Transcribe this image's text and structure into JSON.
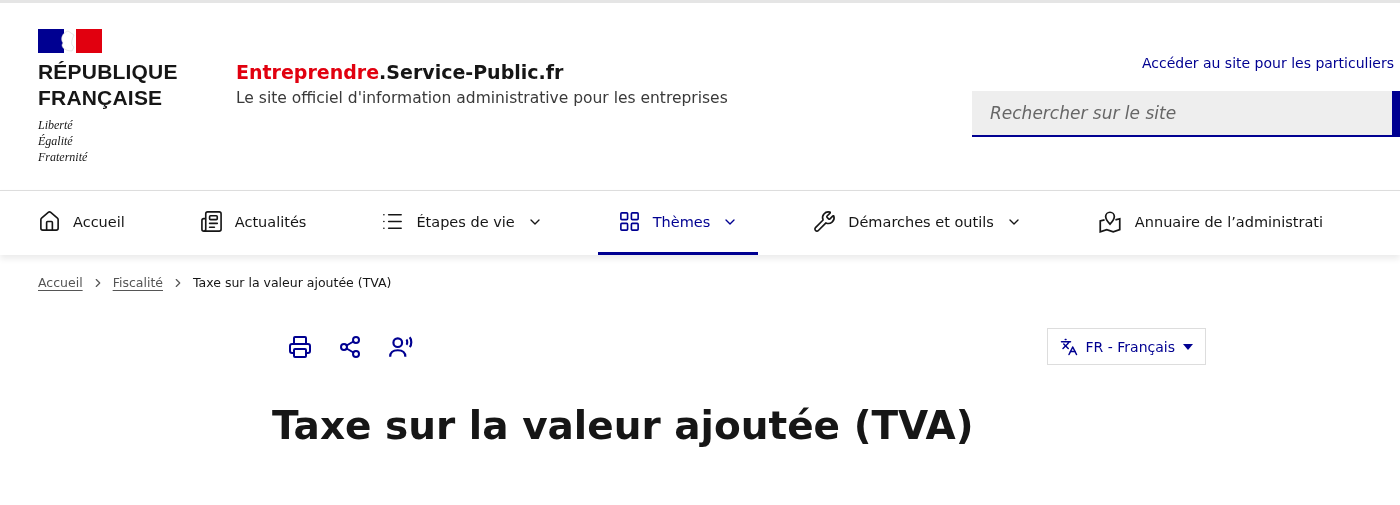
{
  "header": {
    "brand_lines": [
      "RÉPUBLIQUE",
      "FRANÇAISE"
    ],
    "motto": [
      "Liberté",
      "Égalité",
      "Fraternité"
    ],
    "site_name_accent": "Entreprendre",
    "site_name_rest": ".Service-Public.fr",
    "tagline": "Le site officiel d'information administrative pour les entreprises",
    "link": "Accéder au site pour les particuliers",
    "search": {
      "placeholder": "Rechercher sur le site"
    }
  },
  "nav": [
    {
      "label": "Accueil",
      "dropdown": false,
      "selected": false
    },
    {
      "label": "Actualités",
      "dropdown": false,
      "selected": false
    },
    {
      "label": "Étapes de vie",
      "dropdown": true,
      "selected": false
    },
    {
      "label": "Thèmes",
      "dropdown": true,
      "selected": true
    },
    {
      "label": "Démarches et outils",
      "dropdown": true,
      "selected": false
    },
    {
      "label": "Annuaire de l’administrati",
      "dropdown": false,
      "selected": false
    }
  ],
  "breadcrumb": [
    {
      "label": "Accueil",
      "link": true
    },
    {
      "label": "Fiscalité",
      "link": true
    },
    {
      "label": "Taxe sur la valeur ajoutée (TVA)",
      "link": false
    }
  ],
  "language": "FR - Français",
  "title": "Taxe sur la valeur ajoutée (TVA)"
}
